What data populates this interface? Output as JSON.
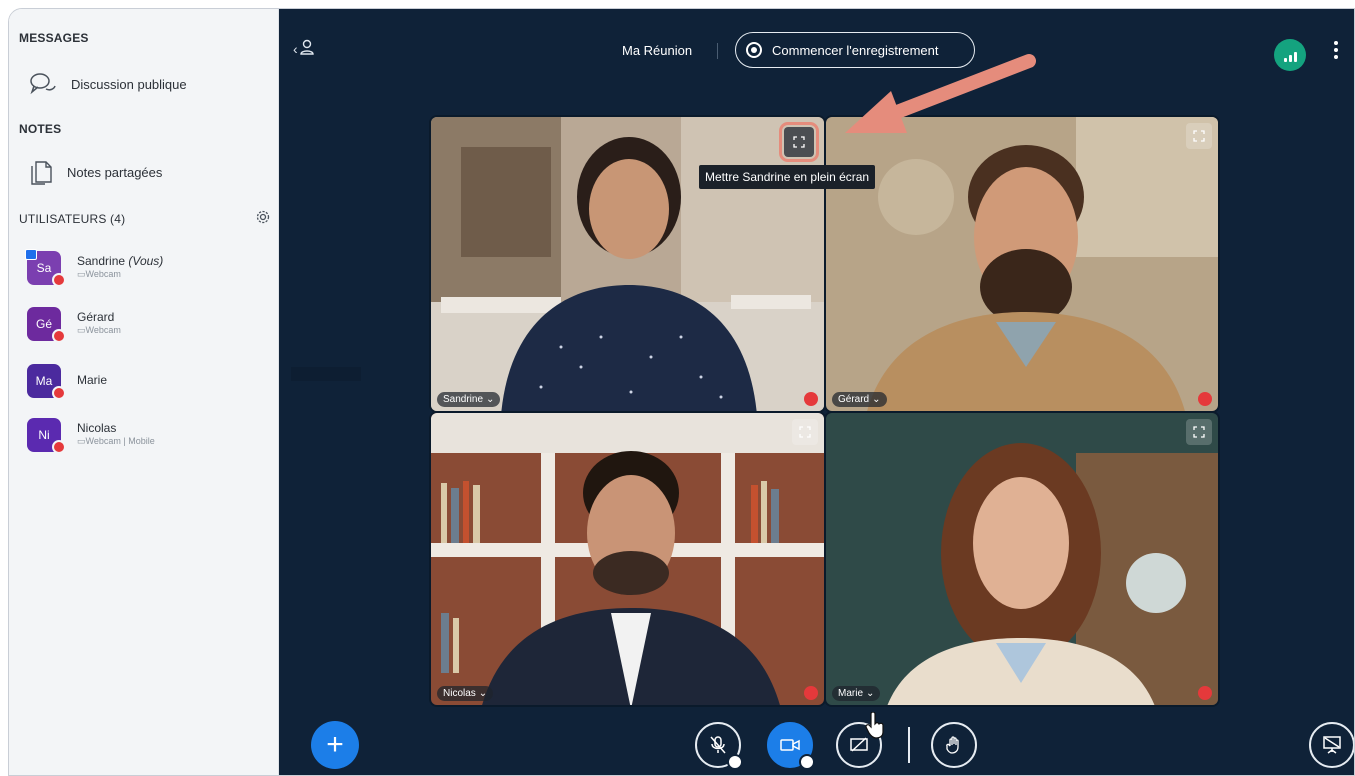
{
  "sidebar": {
    "messages_heading": "MESSAGES",
    "public_chat_label": "Discussion publique",
    "notes_heading": "NOTES",
    "shared_notes_label": "Notes partagées",
    "users_heading": "UTILISATEURS (4)",
    "users": [
      {
        "initials": "Sa",
        "name": "Sandrine",
        "you": "(Vous)",
        "sub": "Webcam",
        "color": "#7b3fb0",
        "presenter": true
      },
      {
        "initials": "Gé",
        "name": "Gérard",
        "you": "",
        "sub": "Webcam",
        "color": "#6d2a9e",
        "presenter": false
      },
      {
        "initials": "Ma",
        "name": "Marie",
        "you": "",
        "sub": "",
        "color": "#4b2a9e",
        "presenter": false
      },
      {
        "initials": "Ni",
        "name": "Nicolas",
        "you": "",
        "sub": "Webcam | Mobile",
        "color": "#5b2ab0",
        "presenter": false
      }
    ]
  },
  "header": {
    "meeting_title": "Ma Réunion",
    "record_label": "Commencer l'enregistrement"
  },
  "videos": [
    {
      "name": "Sandrine"
    },
    {
      "name": "Gérard"
    },
    {
      "name": "Nicolas"
    },
    {
      "name": "Marie"
    }
  ],
  "tooltip": "Mettre Sandrine en plein écran",
  "icons": {
    "chat": "speech-bubbles-icon",
    "notes": "documents-icon",
    "settings": "gear-icon",
    "fullscreen": "expand-icon",
    "mute": "muted-mic-icon",
    "camera": "camera-icon",
    "screenshare": "screen-share-off-icon",
    "hand": "raise-hand-icon",
    "presentation": "presentation-icon",
    "connection": "signal-bars-icon"
  },
  "colors": {
    "main_bg": "#0f2238",
    "accent": "#1c7ee8",
    "mute_red": "#e5393b",
    "highlight": "#e58c7c",
    "connection_green": "#14a37f"
  }
}
